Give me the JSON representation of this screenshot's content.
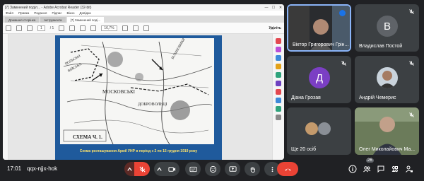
{
  "acrobat": {
    "window_title": "[7] Замкнений поділ... - Adobe Acrobat Reader (32-bit)",
    "menu": [
      "Файл",
      "Правка",
      "Подання",
      "Підпис",
      "Вікно",
      "Довідка"
    ],
    "tabs": [
      "Домашня сторінка",
      "Інструменти",
      "[7] Замкнений поді..."
    ],
    "page_indicator": "1",
    "page_total": "/ 1",
    "zoom": "16,7%",
    "share_label": "Уділіть",
    "caption": "Схема розташування Армії УНР в період з 2 по 15 грудня 1919 року",
    "map_labels": {
      "schema": "СХЕМА Ч. 1.",
      "moskovski": "МОСКОВСЬКІ",
      "dobrovoltsi": "ДОБРОВОЛЬЦІ",
      "polish_1": "ПОЛЬСЬКІ",
      "polish_2": "ВІЙСЬКА",
      "bilshovyky": "БІЛЬШОВИКИ"
    }
  },
  "participants": [
    {
      "name": "Віктор Григорович Грін...",
      "type": "video",
      "speaking": true
    },
    {
      "name": "Владислав Постой",
      "type": "avatar",
      "initial": "В",
      "color": "#5f6368",
      "muted": true
    },
    {
      "name": "Діана Грозав",
      "type": "avatar",
      "initial": "Д",
      "color": "#7b3fc4",
      "muted": true
    },
    {
      "name": "Андрій Чемерис",
      "type": "photo-avatar",
      "muted": true
    },
    {
      "name": "Ще 20 осіб",
      "type": "group"
    },
    {
      "name": "Олег Миколайович Ма...",
      "type": "video",
      "muted": true
    }
  ],
  "bottom": {
    "time": "17:01",
    "meeting_code": "qqx-njjx-hok",
    "participant_count": "26"
  },
  "colors": {
    "mute_red": "#ea4335",
    "hangup_red": "#ea4335",
    "speaking_blue": "#8ab4f8",
    "caption_yellow": "#ffe36a",
    "page_blue": "#1f5a9c"
  }
}
